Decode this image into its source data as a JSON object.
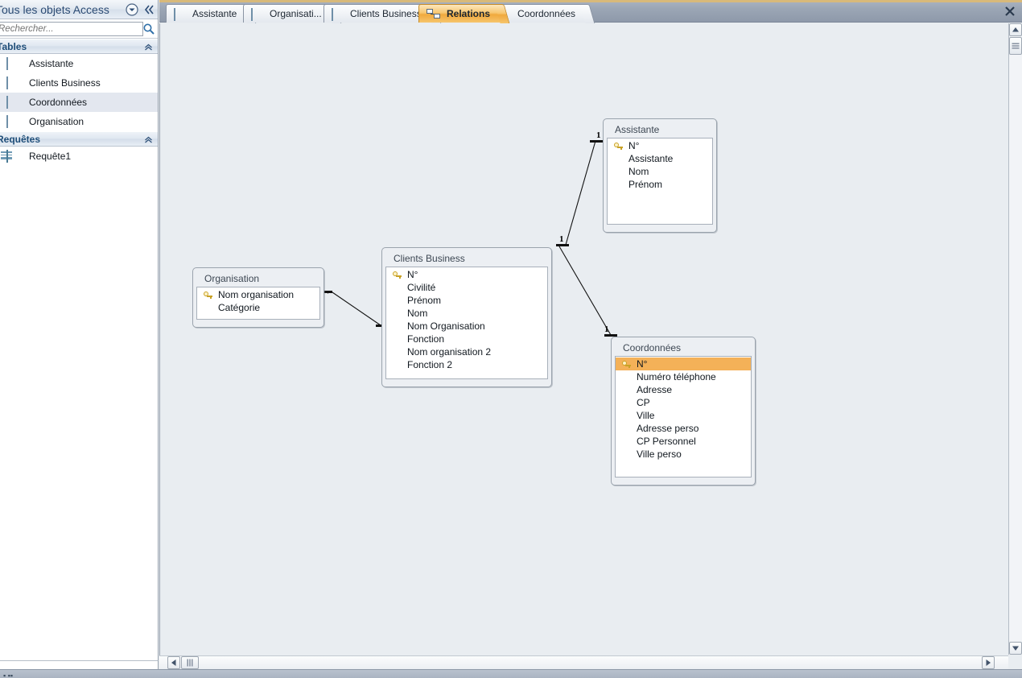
{
  "nav": {
    "title": "Tous les objets Access",
    "dropdown_icon": "chevron-down-circle-icon",
    "collapse_icon": "double-chevron-left-icon",
    "search": {
      "placeholder": "Rechercher...",
      "value": "",
      "icon": "search-icon"
    },
    "groups": [
      {
        "label": "Tables",
        "collapse_icon": "chevron-up-icon",
        "items": [
          {
            "label": "Assistante",
            "icon": "table-icon",
            "selected": false
          },
          {
            "label": "Clients Business",
            "icon": "table-icon",
            "selected": false
          },
          {
            "label": "Coordonnées",
            "icon": "table-icon",
            "selected": true
          },
          {
            "label": "Organisation",
            "icon": "table-icon",
            "selected": false
          }
        ]
      },
      {
        "label": "Requêtes",
        "collapse_icon": "chevron-up-icon",
        "items": [
          {
            "label": "Requête1",
            "icon": "query-icon",
            "selected": false
          }
        ]
      }
    ]
  },
  "tabs": {
    "close_icon": "close-icon",
    "items": [
      {
        "label": "Assistante",
        "icon": "table-icon",
        "active": false
      },
      {
        "label": "Organisati...",
        "icon": "table-icon",
        "active": false
      },
      {
        "label": "Clients Business",
        "icon": "table-icon",
        "active": false
      },
      {
        "label": "Relations",
        "icon": "relations-icon",
        "active": true
      },
      {
        "label": "Coordonnées",
        "icon": "table-icon",
        "active": false
      }
    ]
  },
  "relations": {
    "tables": [
      {
        "id": "organisation",
        "title": "Organisation",
        "fields": [
          {
            "name": "Nom organisation",
            "key": true,
            "selected": false
          },
          {
            "name": "Catégorie",
            "key": false,
            "selected": false
          }
        ]
      },
      {
        "id": "clients_business",
        "title": "Clients Business",
        "fields": [
          {
            "name": "N°",
            "key": true,
            "selected": false
          },
          {
            "name": "Civilité",
            "key": false,
            "selected": false
          },
          {
            "name": "Prénom",
            "key": false,
            "selected": false
          },
          {
            "name": "Nom",
            "key": false,
            "selected": false
          },
          {
            "name": "Nom Organisation",
            "key": false,
            "selected": false
          },
          {
            "name": "Fonction",
            "key": false,
            "selected": false
          },
          {
            "name": "Nom organisation 2",
            "key": false,
            "selected": false
          },
          {
            "name": "Fonction 2",
            "key": false,
            "selected": false
          }
        ]
      },
      {
        "id": "assistante",
        "title": "Assistante",
        "fields": [
          {
            "name": "N°",
            "key": true,
            "selected": false
          },
          {
            "name": "Assistante",
            "key": false,
            "selected": false
          },
          {
            "name": "Nom",
            "key": false,
            "selected": false
          },
          {
            "name": "Prénom",
            "key": false,
            "selected": false
          }
        ]
      },
      {
        "id": "coordonnees",
        "title": "Coordonnées",
        "fields": [
          {
            "name": "N°",
            "key": true,
            "selected": true
          },
          {
            "name": "Numéro téléphone",
            "key": false,
            "selected": false
          },
          {
            "name": "Adresse",
            "key": false,
            "selected": false
          },
          {
            "name": "CP",
            "key": false,
            "selected": false
          },
          {
            "name": "Ville",
            "key": false,
            "selected": false
          },
          {
            "name": "Adresse perso",
            "key": false,
            "selected": false
          },
          {
            "name": "CP Personnel",
            "key": false,
            "selected": false
          },
          {
            "name": "Ville perso",
            "key": false,
            "selected": false
          }
        ]
      }
    ],
    "cardinality_labels": [
      {
        "text": "1",
        "for": "assistante"
      },
      {
        "text": "1",
        "for": "clients_business"
      },
      {
        "text": "1",
        "for": "coordonnees"
      }
    ]
  },
  "scrollbars": {
    "vertical": {
      "up_icon": "scroll-up-arrow-icon",
      "down_icon": "scroll-down-arrow-icon",
      "thumb": "vertical-scroll-thumb"
    },
    "horizontal": {
      "left_icon": "scroll-left-arrow-icon",
      "right_icon": "scroll-right-arrow-icon",
      "thumb": "horizontal-scroll-thumb"
    }
  },
  "colors": {
    "accent_orange": "#f0a93d",
    "selection_orange": "#f4b158",
    "nav_title_blue": "#1f4e79",
    "tabstrip_gray": "#9ba6b5",
    "canvas_gray": "#e9edf1"
  }
}
